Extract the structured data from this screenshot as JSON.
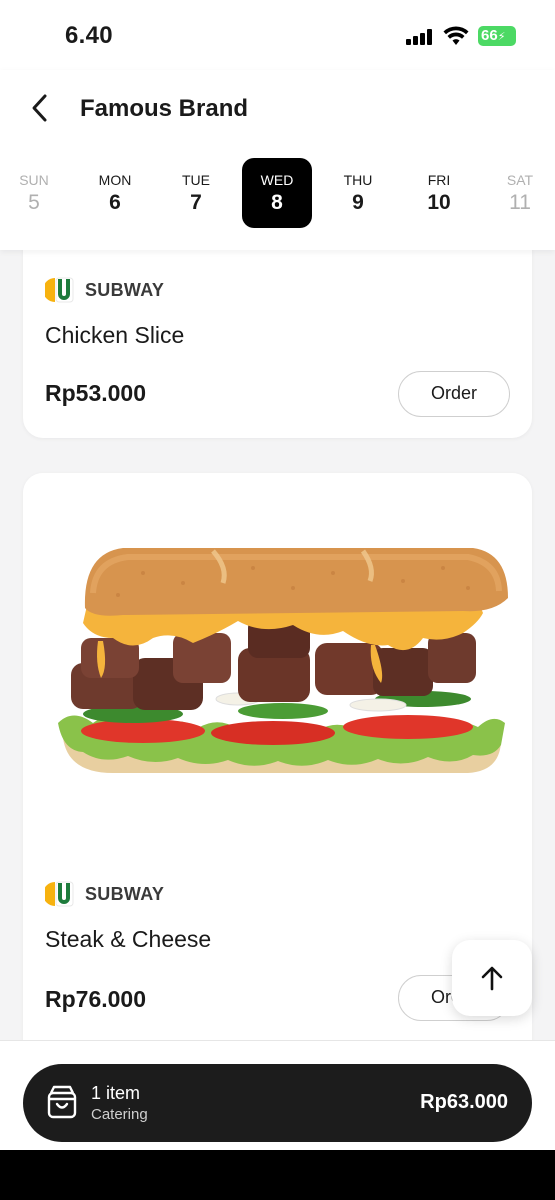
{
  "status": {
    "time": "6.40",
    "battery": "66"
  },
  "header": {
    "title": "Famous Brand"
  },
  "days": [
    {
      "name": "SUN",
      "num": "5"
    },
    {
      "name": "MON",
      "num": "6"
    },
    {
      "name": "TUE",
      "num": "7"
    },
    {
      "name": "WED",
      "num": "8"
    },
    {
      "name": "THU",
      "num": "9"
    },
    {
      "name": "FRI",
      "num": "10"
    },
    {
      "name": "SAT",
      "num": "11"
    }
  ],
  "selected_day": "WED",
  "items": [
    {
      "brand": "SUBWAY",
      "name": "Chicken Slice",
      "price": "Rp53.000",
      "order_label": "Order"
    },
    {
      "brand": "SUBWAY",
      "name": "Steak & Cheese",
      "price": "Rp76.000",
      "order_label": "Order"
    }
  ],
  "cart": {
    "count_label": "1 item",
    "type": "Catering",
    "total": "Rp63.000"
  },
  "colors": {
    "accent": "#000000",
    "battery": "#4cd964",
    "subway_green": "#1e7b3c",
    "subway_yellow": "#f7b20f"
  }
}
